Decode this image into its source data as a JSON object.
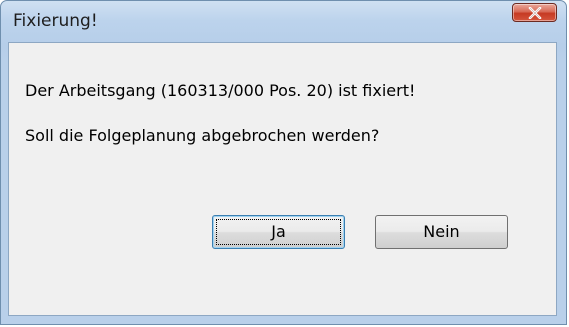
{
  "dialog": {
    "title": "Fixierung!",
    "message_line1": "Der Arbeitsgang (160313/000 Pos. 20) ist fixiert!",
    "message_line2": "Soll die Folgeplanung abgebrochen werden?",
    "buttons": {
      "yes_label": "Ja",
      "no_label": "Nein"
    },
    "close_icon": "close-icon",
    "colors": {
      "title_bar": "#bcd3ec",
      "client_area": "#f0f0f0",
      "close_button": "#c63a23"
    }
  }
}
